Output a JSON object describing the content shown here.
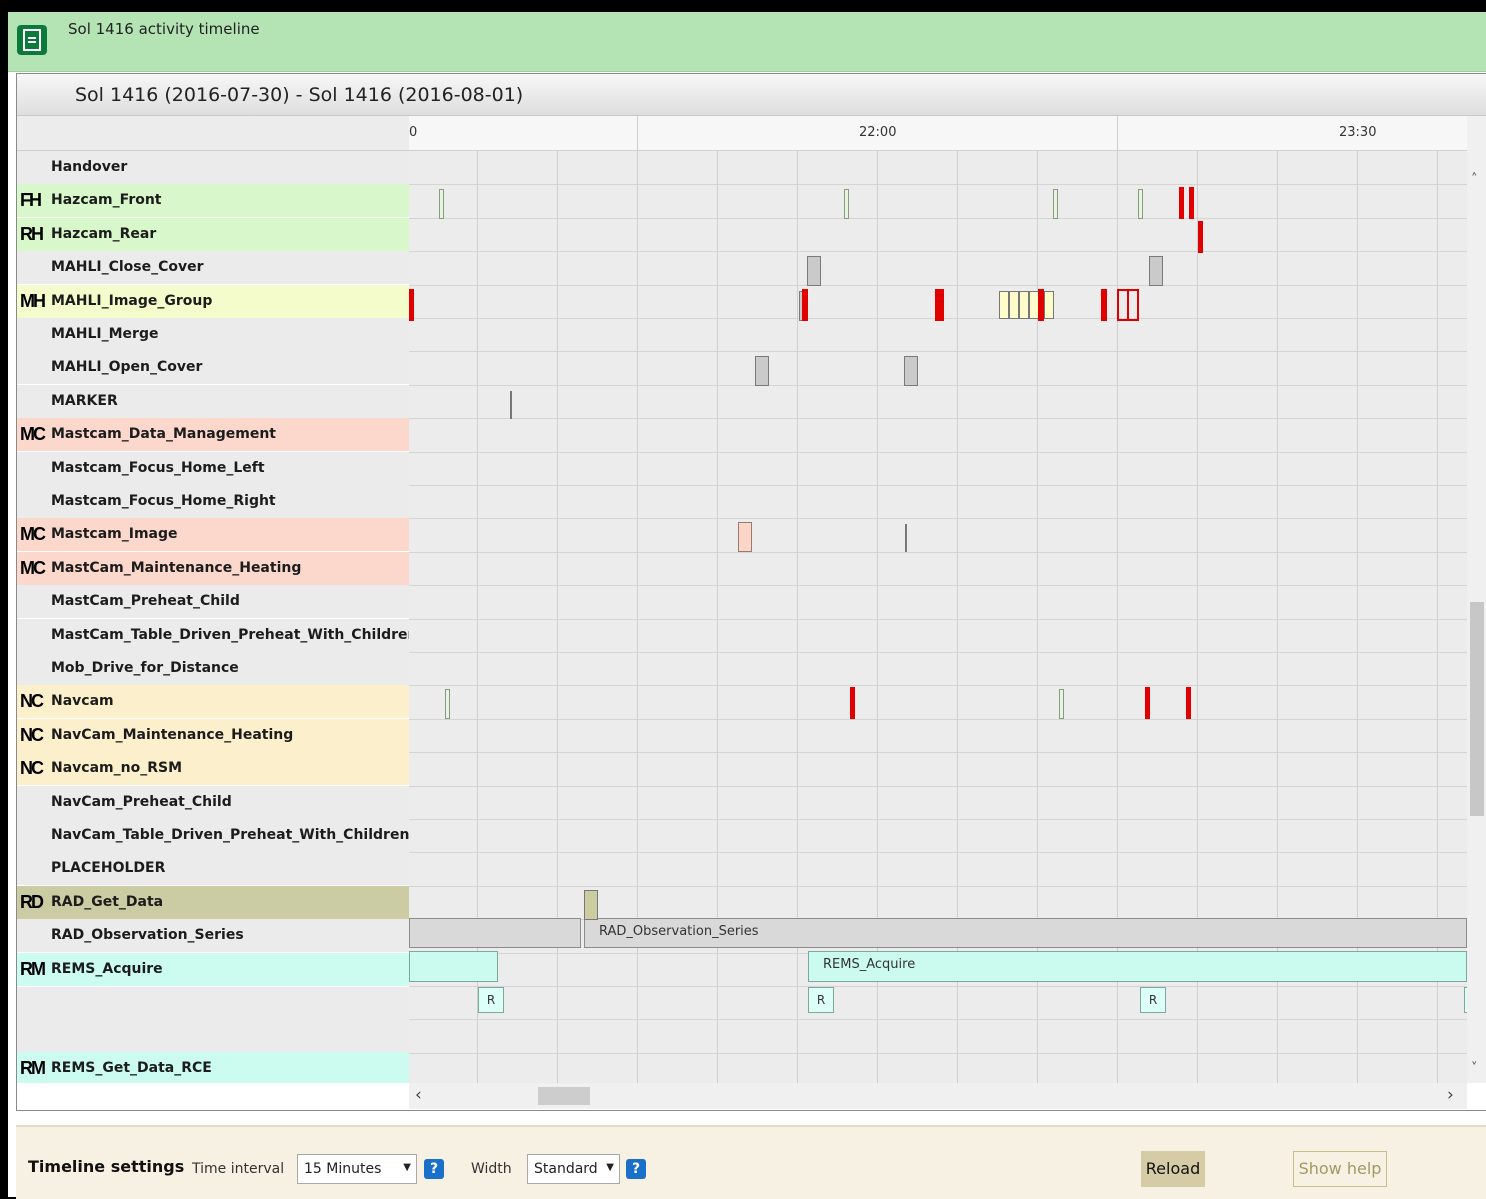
{
  "window": {
    "title": "Sol 1416 activity timeline"
  },
  "timeline": {
    "range_title": "Sol 1416 (2016-07-30) - Sol 1416 (2016-08-01)",
    "axis_labels": [
      "0",
      "22:00",
      "23:30"
    ]
  },
  "rows": [
    {
      "badge": "",
      "label": "Handover",
      "color": "#ebebeb"
    },
    {
      "badge": "FH",
      "label": "Hazcam_Front",
      "color": "#d8f8cc"
    },
    {
      "badge": "RH",
      "label": "Hazcam_Rear",
      "color": "#d8f8cc"
    },
    {
      "badge": "",
      "label": "MAHLI_Close_Cover",
      "color": "#ebebeb"
    },
    {
      "badge": "MH",
      "label": "MAHLI_Image_Group",
      "color": "#f4fccc"
    },
    {
      "badge": "",
      "label": "MAHLI_Merge",
      "color": "#ebebeb"
    },
    {
      "badge": "",
      "label": "MAHLI_Open_Cover",
      "color": "#ebebeb"
    },
    {
      "badge": "",
      "label": "MARKER",
      "color": "#ebebeb"
    },
    {
      "badge": "MC",
      "label": "Mastcam_Data_Management",
      "color": "#fcd8cc"
    },
    {
      "badge": "",
      "label": "Mastcam_Focus_Home_Left",
      "color": "#ebebeb"
    },
    {
      "badge": "",
      "label": "Mastcam_Focus_Home_Right",
      "color": "#ebebeb"
    },
    {
      "badge": "MC",
      "label": "Mastcam_Image",
      "color": "#fcd8cc"
    },
    {
      "badge": "MC",
      "label": "MastCam_Maintenance_Heating",
      "color": "#fcd8cc"
    },
    {
      "badge": "",
      "label": "MastCam_Preheat_Child",
      "color": "#ebebeb"
    },
    {
      "badge": "",
      "label": "MastCam_Table_Driven_Preheat_With_Children",
      "color": "#ebebeb"
    },
    {
      "badge": "",
      "label": "Mob_Drive_for_Distance",
      "color": "#ebebeb"
    },
    {
      "badge": "NC",
      "label": "Navcam",
      "color": "#fcf0cc"
    },
    {
      "badge": "NC",
      "label": "NavCam_Maintenance_Heating",
      "color": "#fcf0cc"
    },
    {
      "badge": "NC",
      "label": "Navcam_no_RSM",
      "color": "#fcf0cc"
    },
    {
      "badge": "",
      "label": "NavCam_Preheat_Child",
      "color": "#ebebeb"
    },
    {
      "badge": "",
      "label": "NavCam_Table_Driven_Preheat_With_Children",
      "color": "#ebebeb"
    },
    {
      "badge": "",
      "label": "PLACEHOLDER",
      "color": "#ebebeb"
    },
    {
      "badge": "RD",
      "label": "RAD_Get_Data",
      "color": "#cccca4"
    },
    {
      "badge": "",
      "label": "RAD_Observation_Series",
      "color": "#ebebeb"
    },
    {
      "badge": "RM",
      "label": "REMS_Acquire",
      "color": "#ccfcf0"
    },
    {
      "badge": "RM",
      "label": "REMS_Get_Data_RCE",
      "color": "#ccfcf0"
    }
  ],
  "bars": {
    "rad_observation_series": "RAD_Observation_Series",
    "rems_acquire": "REMS_Acquire",
    "r_marker": "R"
  },
  "settings": {
    "title": "Timeline settings",
    "interval_label": "Time interval",
    "interval_value": "15 Minutes",
    "width_label": "Width",
    "width_value": "Standard",
    "help_glyph": "?",
    "reload_label": "Reload",
    "show_help_label": "Show help"
  },
  "icons": [
    "document-icon",
    "help-icon",
    "chevron-up-icon",
    "chevron-down-icon",
    "chevron-left-icon",
    "chevron-right-icon"
  ]
}
